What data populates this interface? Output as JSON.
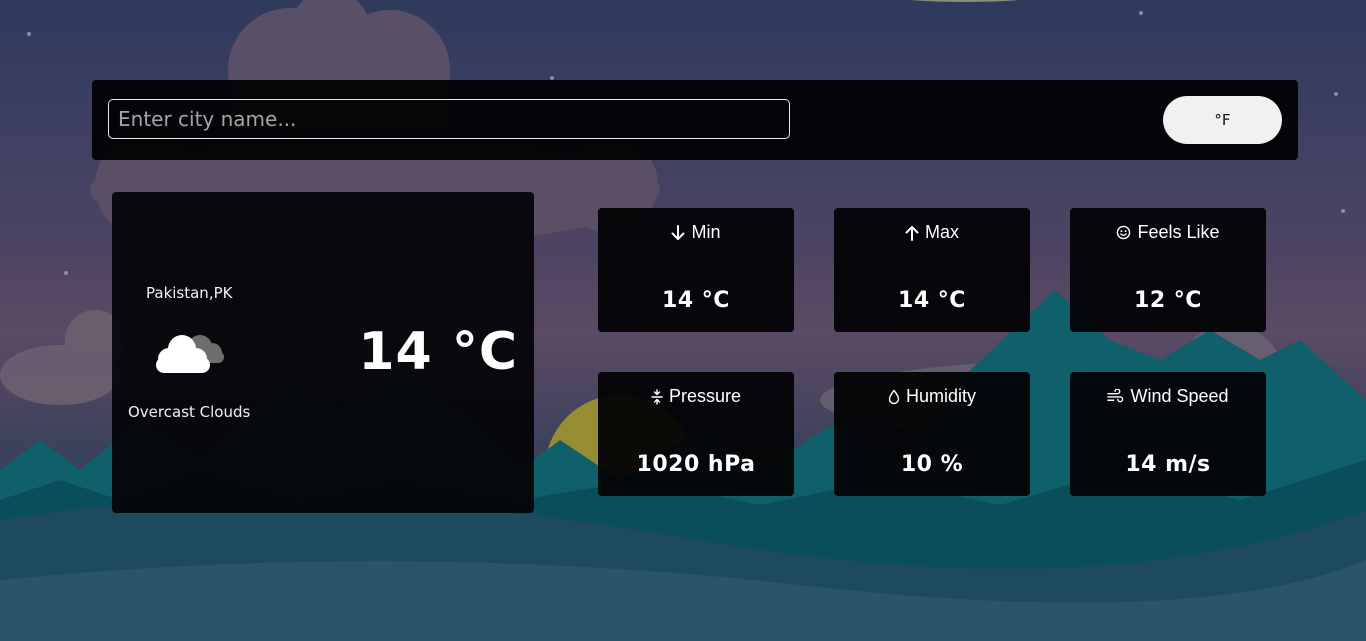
{
  "search": {
    "placeholder": "Enter city name...",
    "value": ""
  },
  "unit_toggle": {
    "label": "°F"
  },
  "current": {
    "location": "Pakistan,PK",
    "icon": "overcast-cloud-icon",
    "description": "Overcast Clouds",
    "temperature": "14 °C"
  },
  "stats": [
    {
      "icon": "arrow-down-icon",
      "label": "Min",
      "value": "14 °C"
    },
    {
      "icon": "arrow-up-icon",
      "label": "Max",
      "value": "14 °C"
    },
    {
      "icon": "smiley-icon",
      "label": "Feels Like",
      "value": "12 °C"
    },
    {
      "icon": "pressure-icon",
      "label": "Pressure",
      "value": "1020 hPa"
    },
    {
      "icon": "droplet-icon",
      "label": "Humidity",
      "value": "10 %"
    },
    {
      "icon": "wind-icon",
      "label": "Wind Speed",
      "value": "14 m/s"
    }
  ],
  "colors": {
    "panel": "#050507",
    "text": "#ffffff",
    "toggle_bg": "#f1f1f1",
    "mountain": "#0f5f6a"
  }
}
